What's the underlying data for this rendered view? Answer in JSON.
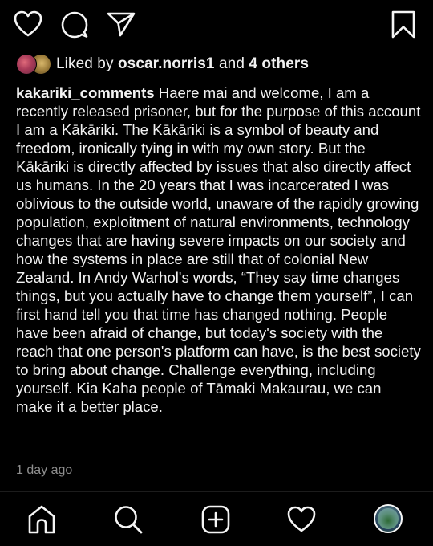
{
  "action_bar": {
    "like_icon": "heart-outline-icon",
    "comment_icon": "comment-bubble-icon",
    "share_icon": "paper-plane-icon",
    "save_icon": "bookmark-icon"
  },
  "likes": {
    "prefix": "Liked by ",
    "first_user": "oscar.norris1",
    "connector": " and ",
    "others": "4 others"
  },
  "caption": {
    "username": "kakariki_comments",
    "text": " Haere mai and welcome, I am a recently released prisoner, but for the purpose of this account I am a Kākāriki. The Kākāriki is a symbol of beauty and freedom, ironically tying in with my own story. But the Kākāriki  is directly affected by issues that also directly affect us humans. In the 20 years that I was incarcerated I was oblivious to the outside world, unaware of the rapidly growing population, exploitment of natural environments, technology changes that are having severe impacts on our society and how the systems in place are still that of colonial New Zealand. In Andy Warhol's words, “They say time changes things, but you actually have to change them yourself”, I can first hand tell you that time has changed nothing. People have been afraid of change, but today's society with the reach that one person's platform can have, is the best society to bring about change. Challenge everything, including yourself. Kia Kaha people of Tāmaki Makaurau, we can make it a better place."
  },
  "timestamp": "1 day ago",
  "bottom_nav": {
    "items": [
      {
        "icon": "home-icon"
      },
      {
        "icon": "search-icon"
      },
      {
        "icon": "add-post-icon"
      },
      {
        "icon": "activity-heart-icon"
      },
      {
        "icon": "profile-avatar"
      }
    ]
  },
  "colors": {
    "background": "#000000",
    "text": "#f2f2f2",
    "muted_text": "#8e8e8e"
  }
}
